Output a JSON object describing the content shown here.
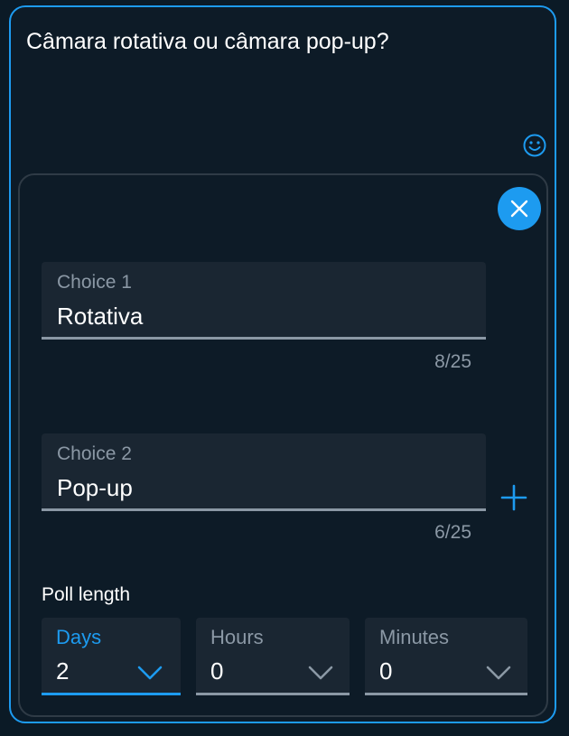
{
  "composer": {
    "text": "Câmara rotativa ou câmara pop-up?"
  },
  "icons": {
    "emoji": "smiley-face-icon",
    "close": "close-x-icon",
    "add": "plus-icon",
    "chevron": "chevron-down-icon"
  },
  "poll": {
    "choices": [
      {
        "label": "Choice 1",
        "value": "Rotativa",
        "counter": "8/25"
      },
      {
        "label": "Choice 2",
        "value": "Pop-up",
        "counter": "6/25"
      }
    ],
    "length": {
      "label": "Poll length",
      "fields": [
        {
          "label": "Days",
          "value": "2",
          "active": true
        },
        {
          "label": "Hours",
          "value": "0",
          "active": false
        },
        {
          "label": "Minutes",
          "value": "0",
          "active": false
        }
      ]
    }
  },
  "colors": {
    "accent": "#1d9bf0",
    "background": "#0d1b27",
    "field": "#1a2632",
    "muted": "#8b98a5",
    "text": "#ffffff",
    "border": "#2f3b46"
  }
}
